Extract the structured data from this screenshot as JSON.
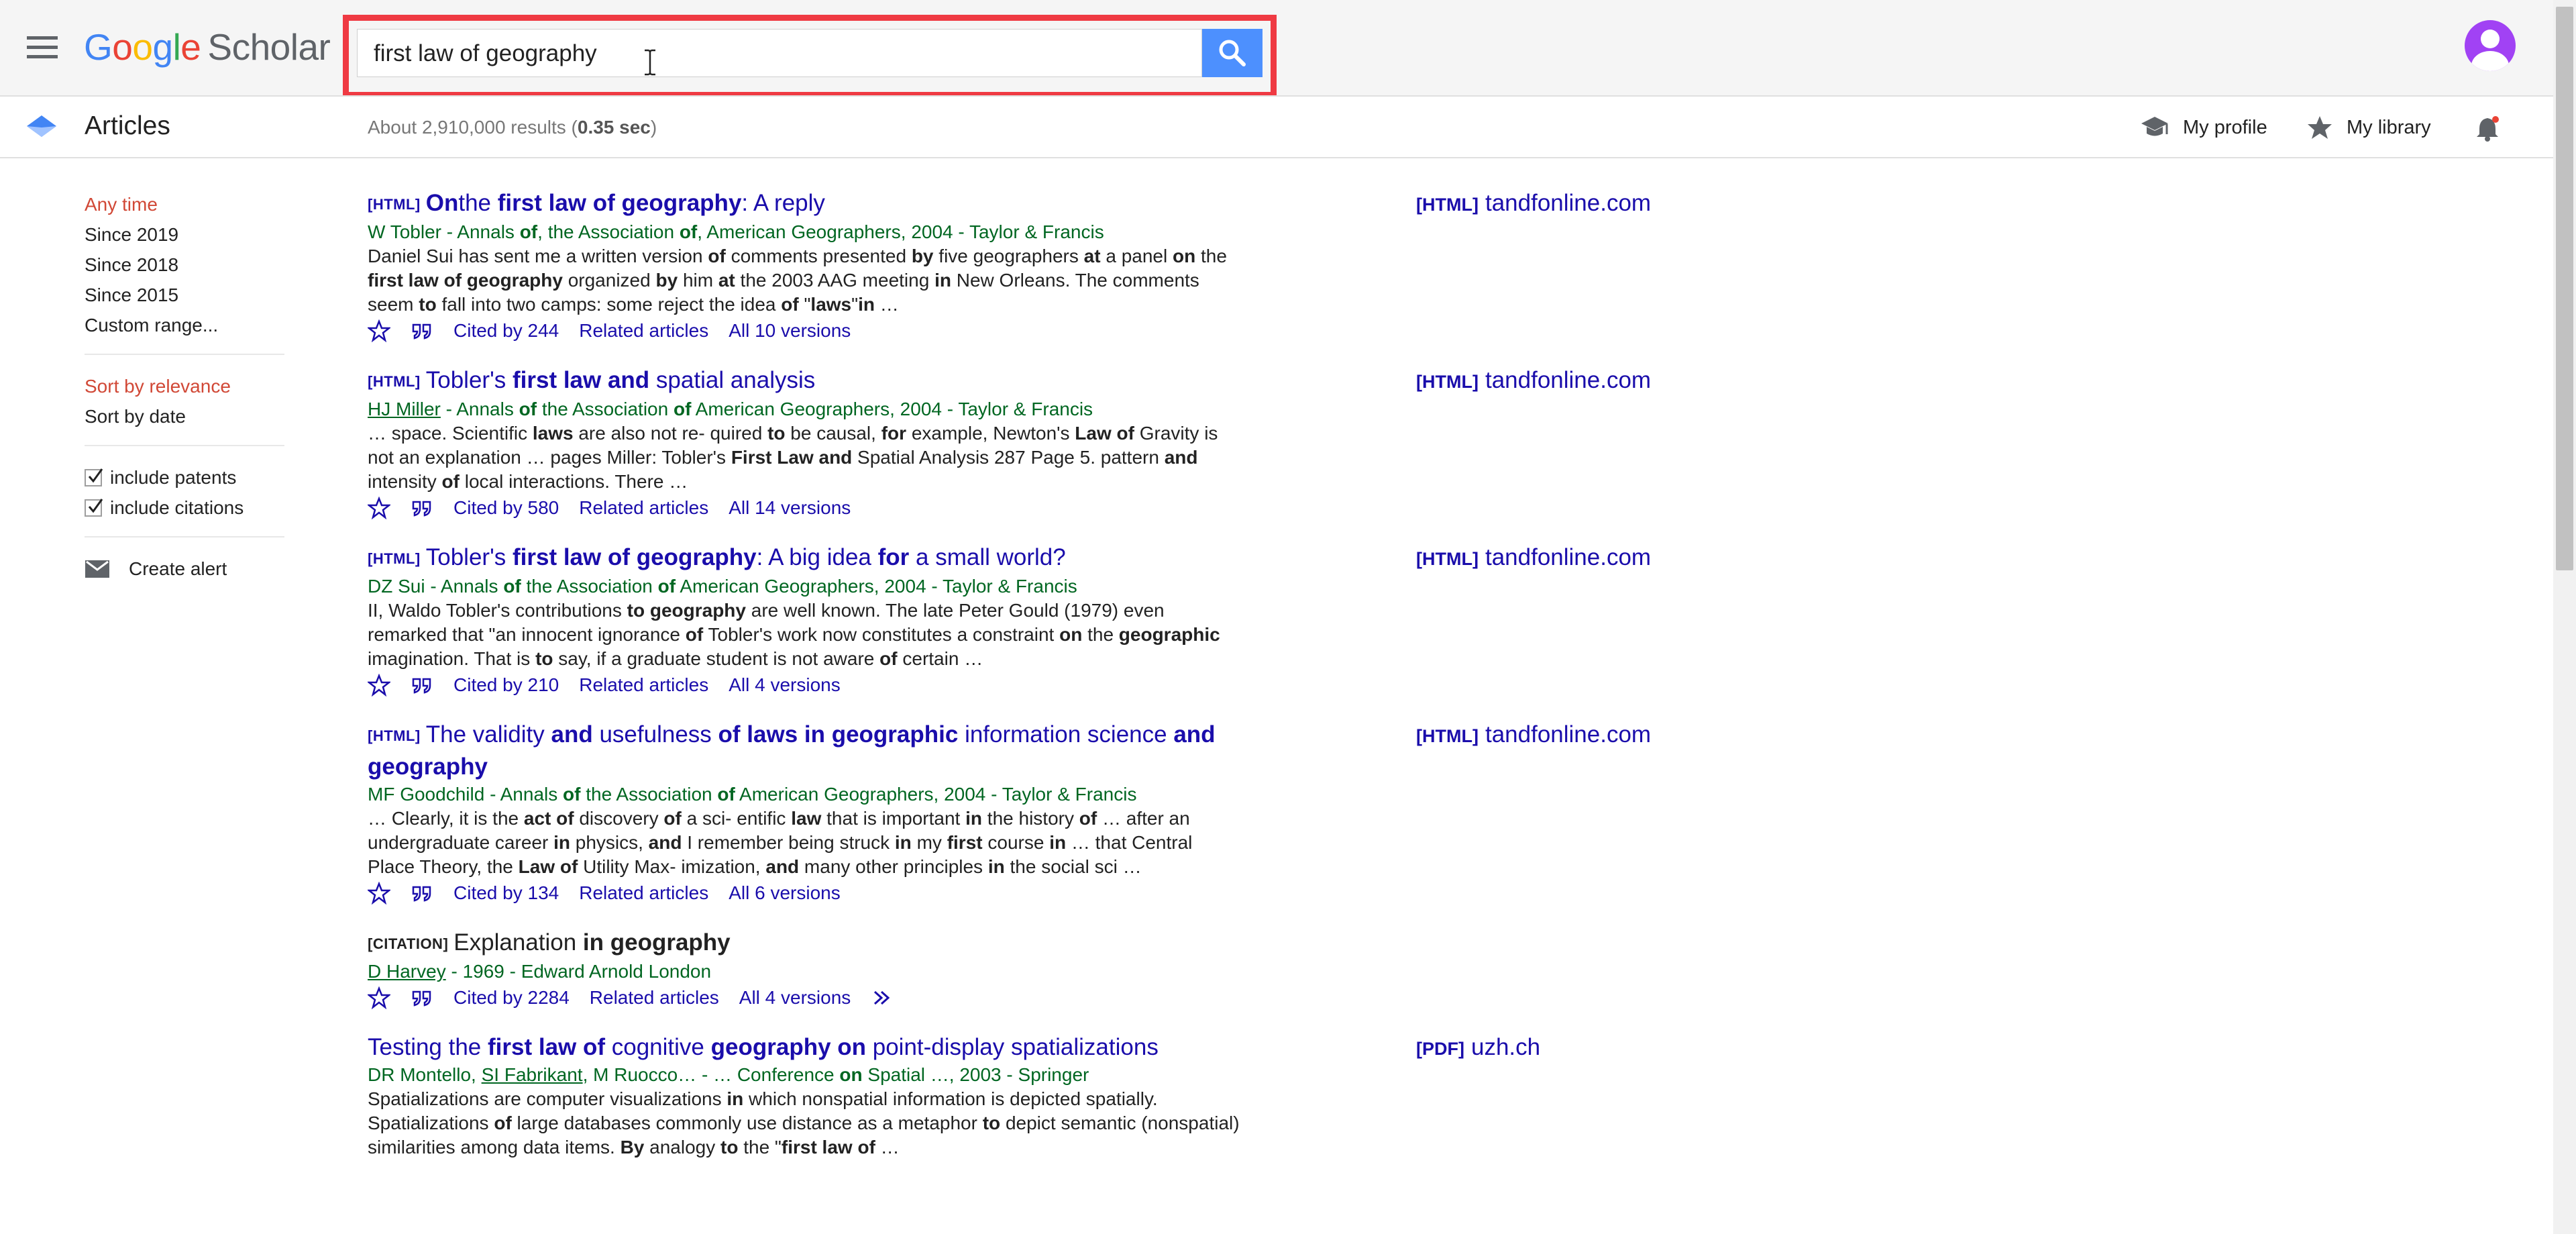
{
  "header": {
    "logo_scholar": "Scholar",
    "search_query": "first law of geography"
  },
  "subheader": {
    "section": "Articles",
    "results_prefix": "About 2,910,000 results (",
    "results_time": "0.35 sec",
    "results_suffix": ")",
    "my_profile": "My profile",
    "my_library": "My library"
  },
  "sidebar": {
    "time_filters": [
      "Any time",
      "Since 2019",
      "Since 2018",
      "Since 2015",
      "Custom range..."
    ],
    "sort_options": [
      "Sort by relevance",
      "Sort by date"
    ],
    "include_patents": "include patents",
    "include_citations": "include citations",
    "create_alert": "Create alert"
  },
  "colors": {
    "accent": "#4d90fe",
    "link": "#1a0dab",
    "authors": "#006621",
    "active_filter": "#d14836",
    "highlight_box": "#ef3a43",
    "avatar": "#a142f4"
  },
  "results": [
    {
      "tag": "[HTML]",
      "title_parts": [
        [
          "b",
          "On"
        ],
        [
          "",
          "the "
        ],
        [
          "b",
          "first law of geography"
        ],
        [
          "",
          ": A reply"
        ]
      ],
      "authors": [
        [
          "",
          "W Tobler - Annals "
        ],
        [
          "b",
          "of"
        ],
        [
          "",
          ", the Association "
        ],
        [
          "b",
          "of"
        ],
        [
          "",
          ", American Geographers, 2004 - Taylor & Francis"
        ]
      ],
      "snippet": [
        [
          "",
          "Daniel Sui has sent me a written version "
        ],
        [
          "b",
          "of"
        ],
        [
          "",
          " comments presented "
        ],
        [
          "b",
          "by"
        ],
        [
          "",
          " five geographers "
        ],
        [
          "b",
          "at"
        ],
        [
          "",
          " a panel "
        ],
        [
          "b",
          "on"
        ],
        [
          "",
          " the "
        ],
        [
          "b",
          "first law of geography"
        ],
        [
          "",
          " organized "
        ],
        [
          "b",
          "by"
        ],
        [
          "",
          " him "
        ],
        [
          "b",
          "at"
        ],
        [
          "",
          " the 2003 AAG meeting "
        ],
        [
          "b",
          "in"
        ],
        [
          "",
          " New Orleans. The comments seem "
        ],
        [
          "b",
          "to"
        ],
        [
          "",
          " fall into two camps: some reject the idea "
        ],
        [
          "b",
          "of"
        ],
        [
          "",
          " \""
        ],
        [
          "b",
          "laws"
        ],
        [
          "",
          "\""
        ],
        [
          "b",
          "in"
        ],
        [
          "",
          " …"
        ]
      ],
      "cited_by": "Cited by 244",
      "related": "Related articles",
      "versions": "All 10 versions",
      "side_tag": "[HTML]",
      "side_source": "tandfonline.com"
    },
    {
      "tag": "[HTML]",
      "title_parts": [
        [
          "",
          "Tobler's "
        ],
        [
          "b",
          "first law and"
        ],
        [
          "",
          " spatial analysis"
        ]
      ],
      "authors": [
        [
          "u",
          "HJ Miller"
        ],
        [
          "",
          " - Annals "
        ],
        [
          "b",
          "of"
        ],
        [
          "",
          " the Association "
        ],
        [
          "b",
          "of"
        ],
        [
          "",
          " American Geographers, 2004 - Taylor & Francis"
        ]
      ],
      "snippet": [
        [
          "",
          "… space. Scientific "
        ],
        [
          "b",
          "laws"
        ],
        [
          "",
          " are also not re- quired "
        ],
        [
          "b",
          "to"
        ],
        [
          "",
          " be causal, "
        ],
        [
          "b",
          "for"
        ],
        [
          "",
          " example, Newton's "
        ],
        [
          "b",
          "Law of"
        ],
        [
          "",
          " Gravity is not an explanation … pages Miller: Tobler's "
        ],
        [
          "b",
          "First Law and"
        ],
        [
          "",
          " Spatial Analysis 287 Page 5. pattern "
        ],
        [
          "b",
          "and"
        ],
        [
          "",
          " intensity "
        ],
        [
          "b",
          "of"
        ],
        [
          "",
          " local interactions. There …"
        ]
      ],
      "cited_by": "Cited by 580",
      "related": "Related articles",
      "versions": "All 14 versions",
      "side_tag": "[HTML]",
      "side_source": "tandfonline.com"
    },
    {
      "tag": "[HTML]",
      "title_parts": [
        [
          "",
          "Tobler's "
        ],
        [
          "b",
          "first law of geography"
        ],
        [
          "",
          ": A big idea "
        ],
        [
          "b",
          "for"
        ],
        [
          "",
          " a small world?"
        ]
      ],
      "authors": [
        [
          "",
          "DZ Sui - Annals "
        ],
        [
          "b",
          "of"
        ],
        [
          "",
          " the Association "
        ],
        [
          "b",
          "of"
        ],
        [
          "",
          " American Geographers, 2004 - Taylor & Francis"
        ]
      ],
      "snippet": [
        [
          "",
          "II, Waldo Tobler's contributions "
        ],
        [
          "b",
          "to geography"
        ],
        [
          "",
          " are well known. The late Peter Gould (1979) even remarked that \"an innocent ignorance "
        ],
        [
          "b",
          "of"
        ],
        [
          "",
          " Tobler's work now constitutes a constraint "
        ],
        [
          "b",
          "on"
        ],
        [
          "",
          " the "
        ],
        [
          "b",
          "geographic"
        ],
        [
          "",
          " imagination. That is "
        ],
        [
          "b",
          "to"
        ],
        [
          "",
          " say, if a graduate student is not aware "
        ],
        [
          "b",
          "of"
        ],
        [
          "",
          " certain …"
        ]
      ],
      "cited_by": "Cited by 210",
      "related": "Related articles",
      "versions": "All 4 versions",
      "side_tag": "[HTML]",
      "side_source": "tandfonline.com"
    },
    {
      "tag": "[HTML]",
      "title_parts": [
        [
          "",
          "The validity "
        ],
        [
          "b",
          "and"
        ],
        [
          "",
          " usefulness "
        ],
        [
          "b",
          "of laws in geographic"
        ],
        [
          "",
          " information science "
        ],
        [
          "b",
          "and geography"
        ]
      ],
      "authors": [
        [
          "",
          "MF Goodchild - Annals "
        ],
        [
          "b",
          "of"
        ],
        [
          "",
          " the Association "
        ],
        [
          "b",
          "of"
        ],
        [
          "",
          " American Geographers, 2004 - Taylor & Francis"
        ]
      ],
      "snippet": [
        [
          "",
          "… Clearly, it is the "
        ],
        [
          "b",
          "act of"
        ],
        [
          "",
          " discovery "
        ],
        [
          "b",
          "of"
        ],
        [
          "",
          " a sci- entific "
        ],
        [
          "b",
          "law"
        ],
        [
          "",
          " that is important "
        ],
        [
          "b",
          "in"
        ],
        [
          "",
          " the history "
        ],
        [
          "b",
          "of"
        ],
        [
          "",
          " … after an undergraduate career "
        ],
        [
          "b",
          "in"
        ],
        [
          "",
          " physics, "
        ],
        [
          "b",
          "and"
        ],
        [
          "",
          " I remember being struck "
        ],
        [
          "b",
          "in"
        ],
        [
          "",
          " my "
        ],
        [
          "b",
          "first"
        ],
        [
          "",
          " course "
        ],
        [
          "b",
          "in"
        ],
        [
          "",
          " … that Central Place Theory, the "
        ],
        [
          "b",
          "Law of"
        ],
        [
          "",
          " Utility Max- imization, "
        ],
        [
          "b",
          "and"
        ],
        [
          "",
          " many other principles "
        ],
        [
          "b",
          "in"
        ],
        [
          "",
          " the social sci …"
        ]
      ],
      "cited_by": "Cited by 134",
      "related": "Related articles",
      "versions": "All 6 versions",
      "side_tag": "[HTML]",
      "side_source": "tandfonline.com"
    },
    {
      "tag": "[CITATION]",
      "citation": true,
      "title_parts": [
        [
          "",
          "Explanation "
        ],
        [
          "b",
          "in geography"
        ]
      ],
      "authors": [
        [
          "u",
          "D Harvey"
        ],
        [
          "",
          " - 1969 - Edward Arnold London"
        ]
      ],
      "snippet": [],
      "cited_by": "Cited by 2284",
      "related": "Related articles",
      "versions": "All 4 versions",
      "side_tag": "",
      "side_source": ""
    },
    {
      "tag": "",
      "title_parts": [
        [
          "",
          "Testing the "
        ],
        [
          "b",
          "first law of"
        ],
        [
          "",
          " cognitive "
        ],
        [
          "b",
          "geography on"
        ],
        [
          "",
          " point-display spatializations"
        ]
      ],
      "authors": [
        [
          "",
          "DR Montello, "
        ],
        [
          "u",
          "SI Fabrikant"
        ],
        [
          "",
          ", M Ruocco… - … Conference "
        ],
        [
          "b",
          "on"
        ],
        [
          "",
          " Spatial …, 2003 - Springer"
        ]
      ],
      "snippet": [
        [
          "",
          "Spatializations are computer visualizations "
        ],
        [
          "b",
          "in"
        ],
        [
          "",
          " which nonspatial information is depicted spatially. Spatializations "
        ],
        [
          "b",
          "of"
        ],
        [
          "",
          " large databases commonly use distance as a metaphor "
        ],
        [
          "b",
          "to"
        ],
        [
          "",
          " depict semantic (nonspatial) similarities among data items. "
        ],
        [
          "b",
          "By"
        ],
        [
          "",
          " analogy "
        ],
        [
          "b",
          "to"
        ],
        [
          "",
          " the \""
        ],
        [
          "b",
          "first law of"
        ],
        [
          "",
          " …"
        ]
      ],
      "cited_by": "",
      "related": "",
      "versions": "",
      "side_tag": "[PDF]",
      "side_source": "uzh.ch"
    }
  ]
}
